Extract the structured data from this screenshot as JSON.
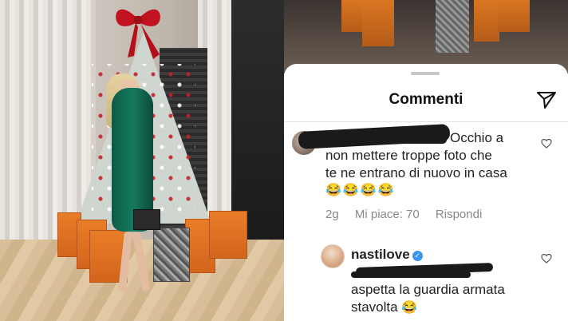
{
  "comments_panel": {
    "title": "Commenti",
    "icons": {
      "send": "send-icon",
      "like": "heart-icon"
    },
    "comments": [
      {
        "text_line1": "Occhio a",
        "text_line2": "non mettere troppe foto che",
        "text_line3": "te ne entrano di nuovo in casa",
        "emoji": "😂😂😂😂",
        "age": "2g",
        "likes": "Mi piace: 70",
        "reply": "Rispondi"
      },
      {
        "username": "nastilove",
        "verified_badge": "✓",
        "text_line1": "aspetta la guardia armata",
        "text_line2": "stavolta",
        "emoji": "😂"
      }
    ]
  },
  "colors": {
    "accent_verified": "#3897f0",
    "bag_orange": "#ea7d28"
  }
}
